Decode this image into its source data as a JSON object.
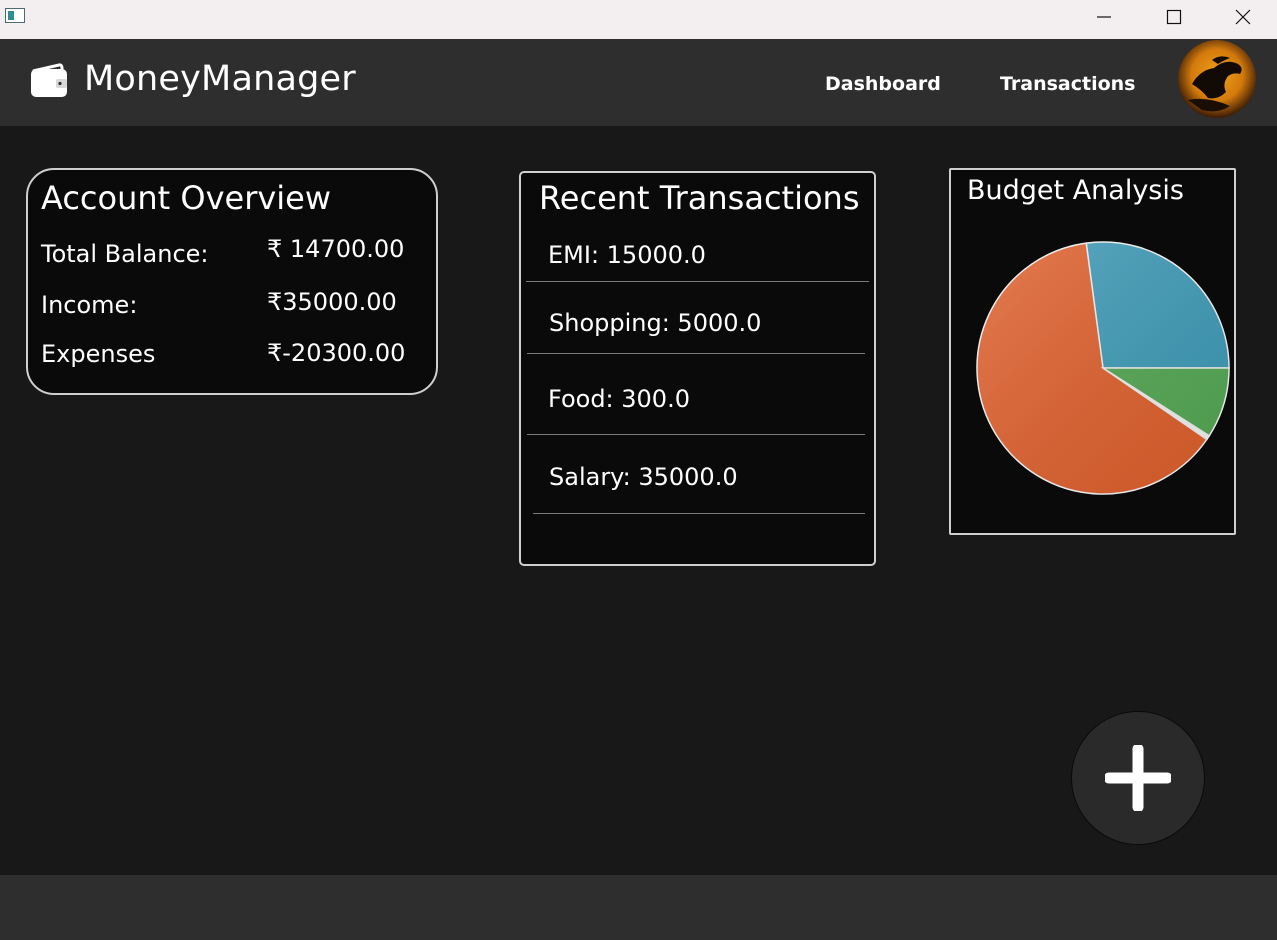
{
  "header": {
    "brand": "MoneyManager",
    "nav": [
      "Dashboard",
      "Transactions"
    ]
  },
  "overview": {
    "title": "Account Overview",
    "rows": [
      {
        "label": "Total Balance:",
        "value": "₹ 14700.00"
      },
      {
        "label": "Income:",
        "value": "₹35000.00"
      },
      {
        "label": "Expenses",
        "value": "₹-20300.00"
      }
    ]
  },
  "recent": {
    "title": "Recent Transactions",
    "items": [
      "EMI: 15000.0",
      "Shopping: 5000.0",
      "Food: 300.0",
      "Salary: 35000.0"
    ]
  },
  "budget": {
    "title": "Budget Analysis"
  },
  "chart_data": {
    "type": "pie",
    "title": "",
    "slices": [
      {
        "value": 15000,
        "color": "#3e9bb8"
      },
      {
        "value": 35000,
        "color": "#e0602c"
      },
      {
        "value": 300,
        "color": "#f4f4f4"
      },
      {
        "value": 5000,
        "color": "#54a954"
      }
    ],
    "start_angle_deg": 0,
    "direction": "counterclockwise",
    "legend": "none"
  },
  "icons": {
    "app": "app-window-icon",
    "wallet": "wallet-icon",
    "avatar": "profile-avatar",
    "add": "plus-icon",
    "minimize": "minimize-icon",
    "maximize": "maximize-icon",
    "close": "close-icon"
  },
  "colors": {
    "background": "#181818",
    "header": "#2e2e2e",
    "card": "#0a0a0a",
    "card_border": "#cfcfcf"
  }
}
